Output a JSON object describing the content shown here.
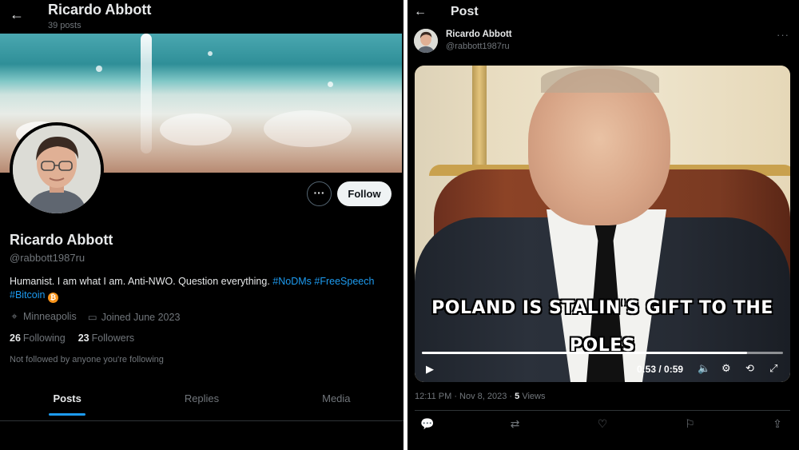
{
  "profile": {
    "header_title": "Ricardo Abbott",
    "header_posts": "39 posts",
    "more_label": "···",
    "follow_label": "Follow",
    "name": "Ricardo Abbott",
    "handle": "@rabbott1987ru",
    "bio_text": "Humanist. I am what I am. Anti-NWO. Question everything. ",
    "bio_tag1": "#NoDMs",
    "bio_tag2": "#FreeSpeech",
    "bio_tag3": "#Bitcoin",
    "bitcoin_glyph": "₿",
    "location": "Minneapolis",
    "joined": "Joined June 2023",
    "following_count": "26",
    "following_label": "Following",
    "followers_count": "23",
    "followers_label": "Followers",
    "not_followed": "Not followed by anyone you're following",
    "tabs": [
      {
        "label": "Posts"
      },
      {
        "label": "Replies"
      },
      {
        "label": "Media"
      }
    ]
  },
  "post": {
    "header_title": "Post",
    "author_name": "Ricardo Abbott",
    "author_handle": "@rabbott1987ru",
    "more_label": "···",
    "caption_line1": "POLAND IS STALIN'S GIFT TO THE",
    "caption_line2": "POLES",
    "video_time": "0:53 / 0:59",
    "progress": 0.9,
    "timestamp": "12:11 PM · Nov 8, 2023 · ",
    "views_count": "5",
    "views_label": " Views"
  },
  "icons": {
    "back": "←",
    "location": "⌖",
    "calendar": "▭",
    "play": "▶",
    "volume": "🔈",
    "settings": "⚙",
    "loop": "⟲",
    "fullscreen": "⤢",
    "reply": "💬",
    "repost": "⇄",
    "like": "♡",
    "bookmark": "⚐",
    "share": "⇪"
  },
  "colors": {
    "accent": "#1d9bf0",
    "background": "#000000",
    "muted_text": "#71767b",
    "bitcoin": "#f7931a"
  }
}
